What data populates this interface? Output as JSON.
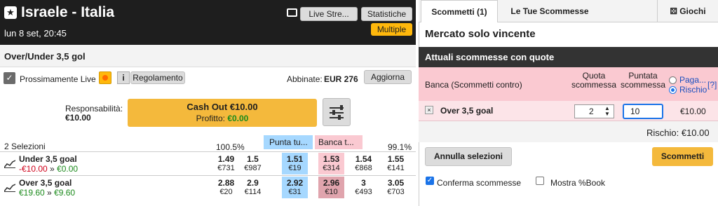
{
  "event": {
    "title": "Israele - Italia",
    "date": "lun 8 set, 20:45",
    "live_stream_label": "Live Stre...",
    "statistiche_label": "Statistiche",
    "multiple_label": "Multiple"
  },
  "market": {
    "name": "Over/Under 3,5 gol",
    "prossimamente_label": "Prossimamente Live",
    "info_label": "i",
    "regolamento_label": "Regolamento",
    "abbinate_label": "Abbinate:",
    "abbinate_value": "EUR 276",
    "aggiorna_label": "Aggiorna",
    "responsabilita_label": "Responsabilità:",
    "responsabilita_value": "€10.00",
    "cashout_label": "Cash Out €10.00",
    "profitto_label": "Profitto:",
    "profitto_value": "€0.00",
    "selezioni_label": "2 Selezioni",
    "back_pct": "100.5%",
    "punta_label": "Punta tu...",
    "banca_label": "Banca t...",
    "lay_pct": "99.1%"
  },
  "runners": [
    {
      "name": "Under 3,5 goal",
      "pl_a": "-€10.00",
      "pl_arrow": "»",
      "pl_b": "€0.00",
      "cells": [
        {
          "price": "1.49",
          "size": "€731"
        },
        {
          "price": "1.5",
          "size": "€987"
        },
        {
          "price": "1.51",
          "size": "€19"
        },
        {
          "price": "1.53",
          "size": "€314"
        },
        {
          "price": "1.54",
          "size": "€868"
        },
        {
          "price": "1.55",
          "size": "€141"
        }
      ]
    },
    {
      "name": "Over 3,5 goal",
      "pl_a": "€19.60",
      "pl_arrow": "»",
      "pl_b": "€9.60",
      "cells": [
        {
          "price": "2.88",
          "size": "€20"
        },
        {
          "price": "2.9",
          "size": "€114"
        },
        {
          "price": "2.92",
          "size": "€31"
        },
        {
          "price": "2.96",
          "size": "€10"
        },
        {
          "price": "3",
          "size": "€493"
        },
        {
          "price": "3.05",
          "size": "€703"
        }
      ]
    }
  ],
  "betslip": {
    "tab1": "Scommetti (1)",
    "tab2": "Le Tue Scommesse",
    "giochi": "Giochi",
    "mercato": "Mercato solo vincente",
    "attuali": "Attuali scommesse con quote",
    "banca_title": "Banca (Scommetti contro)",
    "quota_header": "Quota scommessa",
    "puntata_header": "Puntata scommessa",
    "paga_label": "Paga...",
    "rischio_label": "Rischio",
    "help_label": "[?]",
    "close_label": "×",
    "bet_name": "Over 3,5 goal",
    "odds_value": "2",
    "stake_value": "10",
    "liability": "€10.00",
    "rischio_total": "Rischio: €10.00",
    "annulla_label": "Annulla selezioni",
    "scommetti_label": "Scommetti",
    "conferma_label": "Conferma scommesse",
    "mostra_label": "Mostra %Book"
  },
  "colors": {
    "back": "#a6d8ff",
    "lay": "#fac9d1",
    "accent": "#f4b93c",
    "header": "#1e1e1e"
  }
}
